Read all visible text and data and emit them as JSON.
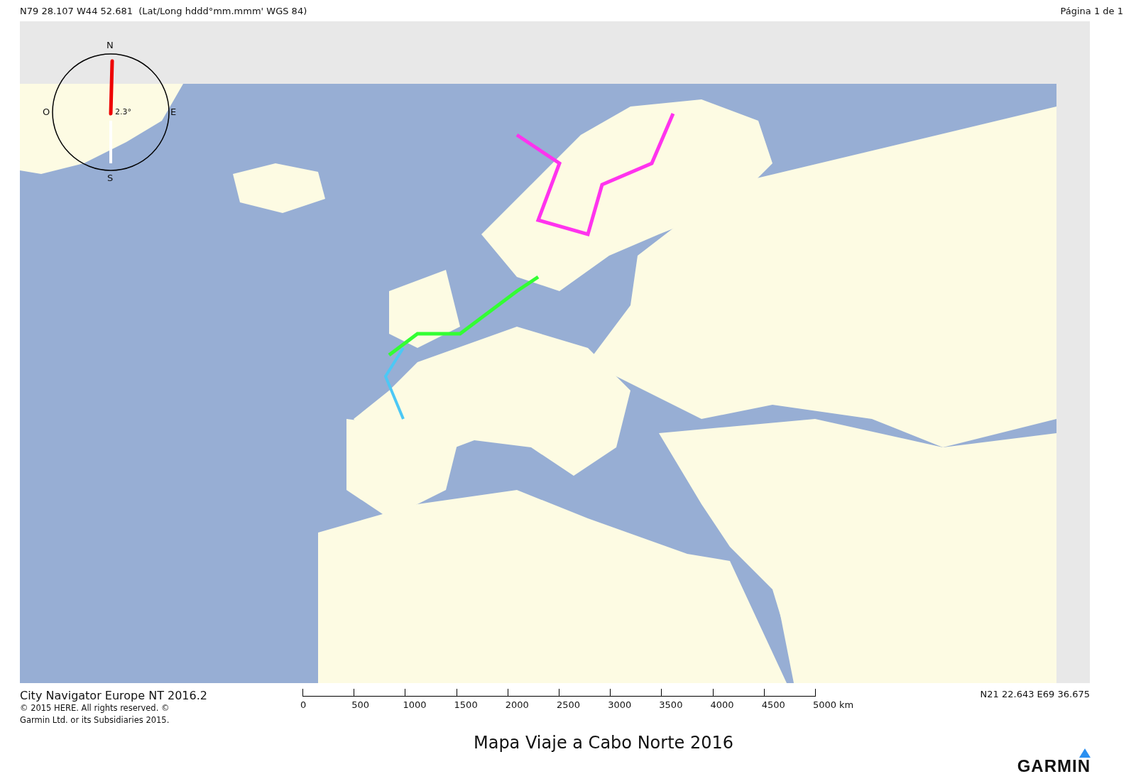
{
  "header": {
    "cursor_position": "N79 28.107 W44 52.681  (Lat/Long hddd°mm.mmm' WGS 84)",
    "page": "Página 1 de 1"
  },
  "map": {
    "kind": "picture",
    "compass": {
      "north": "N",
      "south": "S",
      "east": "E",
      "west": "O",
      "rotation": "2.3°"
    }
  },
  "footer": {
    "map_product": "City Navigator Europe NT 2016.2",
    "copyright": [
      "© 2015 HERE. All rights reserved. ©",
      "Garmin Ltd. or its Subsidiaries 2015."
    ],
    "scale": [
      "0",
      "500",
      "1000",
      "1500",
      "2000",
      "2500",
      "3000",
      "3500",
      "4000",
      "4500",
      "5000 km"
    ],
    "corner_position": "N21 22.643 E69 36.675"
  },
  "title": "Mapa Viaje a Cabo Norte 2016",
  "logo": "GARMIN"
}
